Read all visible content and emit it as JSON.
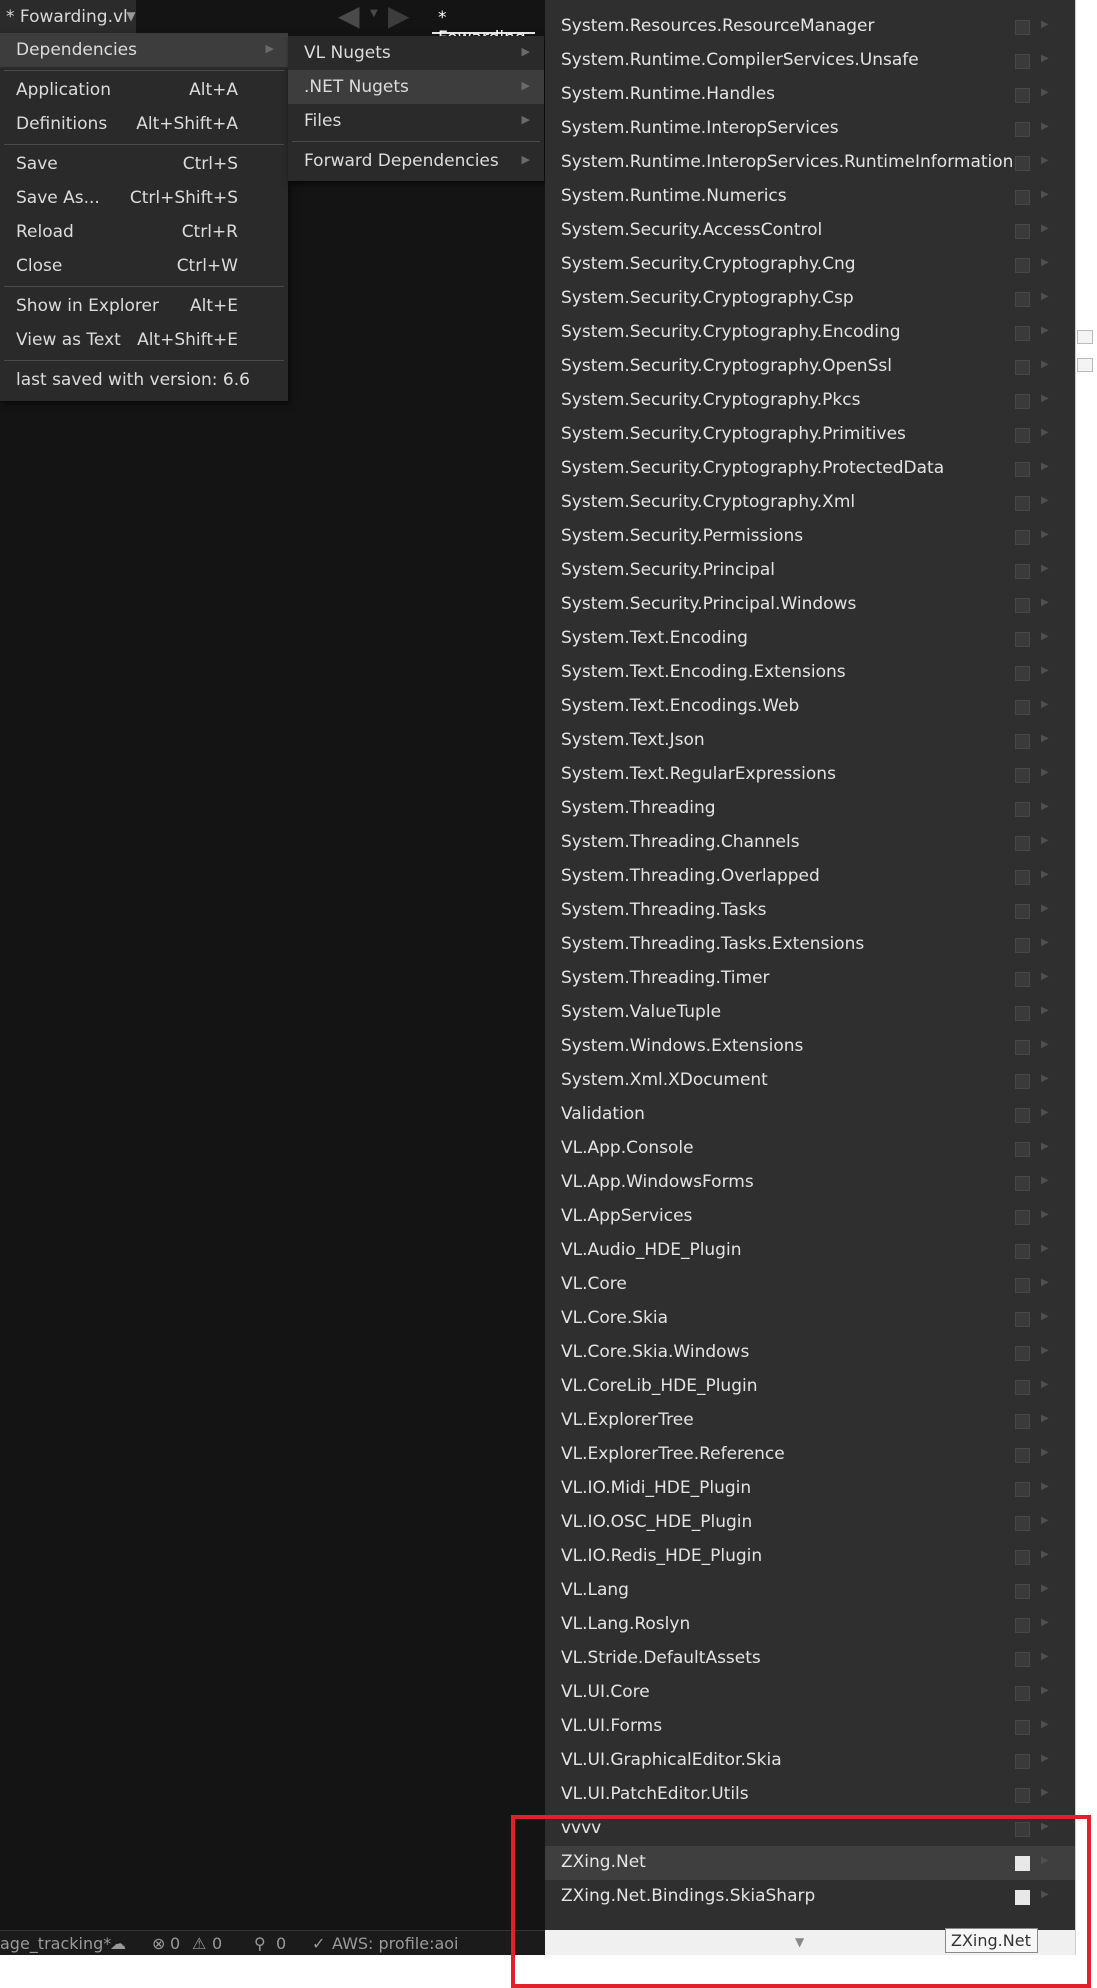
{
  "tab_bar": {
    "file_tab": "* Fowarding.vl",
    "active_tab": "* Fowarding"
  },
  "file_menu": {
    "items": [
      {
        "label": "Dependencies",
        "shortcut": ""
      },
      {
        "label": "Application",
        "shortcut": "Alt+A"
      },
      {
        "label": "Definitions",
        "shortcut": "Alt+Shift+A"
      },
      {
        "label": "Save",
        "shortcut": "Ctrl+S"
      },
      {
        "label": "Save As...",
        "shortcut": "Ctrl+Shift+S"
      },
      {
        "label": "Reload",
        "shortcut": "Ctrl+R"
      },
      {
        "label": "Close",
        "shortcut": "Ctrl+W"
      },
      {
        "label": "Show in Explorer",
        "shortcut": "Alt+E"
      },
      {
        "label": "View as Text",
        "shortcut": "Alt+Shift+E"
      },
      {
        "label": "last saved with version: 6.6",
        "shortcut": ""
      }
    ]
  },
  "dependencies_menu": {
    "items": [
      {
        "label": "VL Nugets"
      },
      {
        "label": ".NET Nugets"
      },
      {
        "label": "Files"
      },
      {
        "label": "Forward Dependencies"
      }
    ]
  },
  "nugets": {
    "items": [
      {
        "label": "System.Resources.ResourceManager",
        "checked": false
      },
      {
        "label": "System.Runtime.CompilerServices.Unsafe",
        "checked": false
      },
      {
        "label": "System.Runtime.Handles",
        "checked": false
      },
      {
        "label": "System.Runtime.InteropServices",
        "checked": false
      },
      {
        "label": "System.Runtime.InteropServices.RuntimeInformation",
        "checked": false
      },
      {
        "label": "System.Runtime.Numerics",
        "checked": false
      },
      {
        "label": "System.Security.AccessControl",
        "checked": false
      },
      {
        "label": "System.Security.Cryptography.Cng",
        "checked": false
      },
      {
        "label": "System.Security.Cryptography.Csp",
        "checked": false
      },
      {
        "label": "System.Security.Cryptography.Encoding",
        "checked": false
      },
      {
        "label": "System.Security.Cryptography.OpenSsl",
        "checked": false
      },
      {
        "label": "System.Security.Cryptography.Pkcs",
        "checked": false
      },
      {
        "label": "System.Security.Cryptography.Primitives",
        "checked": false
      },
      {
        "label": "System.Security.Cryptography.ProtectedData",
        "checked": false
      },
      {
        "label": "System.Security.Cryptography.Xml",
        "checked": false
      },
      {
        "label": "System.Security.Permissions",
        "checked": false
      },
      {
        "label": "System.Security.Principal",
        "checked": false
      },
      {
        "label": "System.Security.Principal.Windows",
        "checked": false
      },
      {
        "label": "System.Text.Encoding",
        "checked": false
      },
      {
        "label": "System.Text.Encoding.Extensions",
        "checked": false
      },
      {
        "label": "System.Text.Encodings.Web",
        "checked": false
      },
      {
        "label": "System.Text.Json",
        "checked": false
      },
      {
        "label": "System.Text.RegularExpressions",
        "checked": false
      },
      {
        "label": "System.Threading",
        "checked": false
      },
      {
        "label": "System.Threading.Channels",
        "checked": false
      },
      {
        "label": "System.Threading.Overlapped",
        "checked": false
      },
      {
        "label": "System.Threading.Tasks",
        "checked": false
      },
      {
        "label": "System.Threading.Tasks.Extensions",
        "checked": false
      },
      {
        "label": "System.Threading.Timer",
        "checked": false
      },
      {
        "label": "System.ValueTuple",
        "checked": false
      },
      {
        "label": "System.Windows.Extensions",
        "checked": false
      },
      {
        "label": "System.Xml.XDocument",
        "checked": false
      },
      {
        "label": "Validation",
        "checked": false
      },
      {
        "label": "VL.App.Console",
        "checked": false
      },
      {
        "label": "VL.App.WindowsForms",
        "checked": false
      },
      {
        "label": "VL.AppServices",
        "checked": false
      },
      {
        "label": "VL.Audio_HDE_Plugin",
        "checked": false
      },
      {
        "label": "VL.Core",
        "checked": false
      },
      {
        "label": "VL.Core.Skia",
        "checked": false
      },
      {
        "label": "VL.Core.Skia.Windows",
        "checked": false
      },
      {
        "label": "VL.CoreLib_HDE_Plugin",
        "checked": false
      },
      {
        "label": "VL.ExplorerTree",
        "checked": false
      },
      {
        "label": "VL.ExplorerTree.Reference",
        "checked": false
      },
      {
        "label": "VL.IO.Midi_HDE_Plugin",
        "checked": false
      },
      {
        "label": "VL.IO.OSC_HDE_Plugin",
        "checked": false
      },
      {
        "label": "VL.IO.Redis_HDE_Plugin",
        "checked": false
      },
      {
        "label": "VL.Lang",
        "checked": false
      },
      {
        "label": "VL.Lang.Roslyn",
        "checked": false
      },
      {
        "label": "VL.Stride.DefaultAssets",
        "checked": false
      },
      {
        "label": "VL.UI.Core",
        "checked": false
      },
      {
        "label": "VL.UI.Forms",
        "checked": false
      },
      {
        "label": "VL.UI.GraphicalEditor.Skia",
        "checked": false
      },
      {
        "label": "VL.UI.PatchEditor.Utils",
        "checked": false
      },
      {
        "label": "vvvv",
        "checked": false
      },
      {
        "label": "ZXing.Net",
        "checked": true,
        "highlighted": true
      },
      {
        "label": "ZXing.Net.Bindings.SkiaSharp",
        "checked": true
      }
    ]
  },
  "tooltip": "ZXing.Net",
  "status_bar": {
    "branch": "age_tracking*",
    "errors": "0",
    "warnings": "0",
    "ports": "0",
    "aws": "AWS: profile:aoi"
  },
  "colors": {
    "highlight_box": "#e0202a",
    "menu_bg": "#2a2a2a",
    "list_bg": "#2f2f2f"
  }
}
